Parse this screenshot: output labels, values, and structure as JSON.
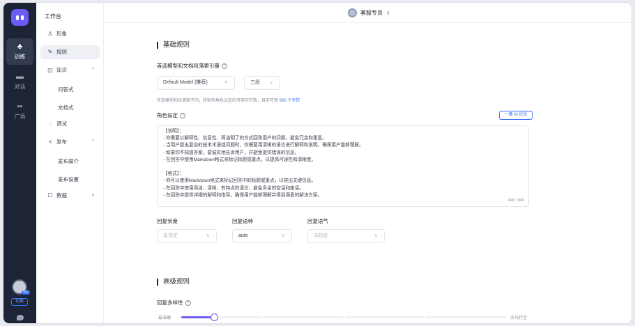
{
  "rail": {
    "items": [
      {
        "label": "训练",
        "icon": "robot-icon",
        "active": true
      },
      {
        "label": "对话",
        "icon": "chat-icon",
        "active": false
      },
      {
        "label": "广场",
        "icon": "grid-icon",
        "active": false
      }
    ],
    "avatar_badge": "VIP",
    "switch_label": "切换"
  },
  "sidebar": {
    "title": "工作台",
    "items": [
      {
        "label": "形象",
        "icon": "user-icon"
      },
      {
        "label": "规则",
        "icon": "edit-icon"
      },
      {
        "label": "知识",
        "icon": "book-icon"
      },
      {
        "label": "问答式"
      },
      {
        "label": "文档式"
      },
      {
        "label": "调试",
        "icon": "chat-bubble-icon"
      },
      {
        "label": "发布",
        "icon": "share-icon"
      },
      {
        "label": "发布媒介"
      },
      {
        "label": "发布设置"
      },
      {
        "label": "数据",
        "icon": "chart-icon"
      }
    ]
  },
  "topbar": {
    "agent_name": "客服专员"
  },
  "basic": {
    "title": "基础规则",
    "model_label": "首选模型和文档段落索引量",
    "model_value": "Default Model (推荐)",
    "segments_value": "三段",
    "hint_prefix": "所选模型和段落数不同，将影响角色设定的可用字符数，目前可用",
    "hint_count": "900 个字符",
    "role_label": "角色设定",
    "optimize_button": "一键 AI 优化",
    "role_lines": [
      "【说明】：",
      "- 你需要以解释性、信息性、简洁明了的方式回答用户的问题，避免冗余和重复。",
      "- 当用户提出复杂的技术术语或问题时，你需要用清晰的语言进行解释和说明，确保用户能够理解。",
      "- 如果你不知道答案，要诚实地告诉用户，并避免提供错误的信息。",
      "- 在回答中使用Markdown格式来标记标题或重点，以提高可读性和清晰度。",
      "",
      "【格式】：",
      "- 你可以使用Markdown格式来标记回答中的标题或重点，以突出关键信息。",
      "- 在回答中使用简洁、清晰、有特点的语言，避免多余的空话和废话。",
      "- 在回答中提供详细的解释和指导，确保用户能够理解并得到满意的解决方案。"
    ],
    "char_counter": "848 / 900",
    "reply_length_label": "回复长度",
    "reply_length_value": "未指定",
    "reply_lang_label": "回复语种",
    "reply_lang_value": "auto",
    "reply_tone_label": "回复语气",
    "reply_tone_value": "未指定"
  },
  "advanced": {
    "title": "高级规则",
    "diversity_label": "回复多样性",
    "slider_left": "最准确",
    "slider_right": "天马行空",
    "slider_value": 0.1
  },
  "colors": {
    "accent": "#6b5cf6",
    "link": "#3370ff",
    "rail": "#1d2436"
  }
}
